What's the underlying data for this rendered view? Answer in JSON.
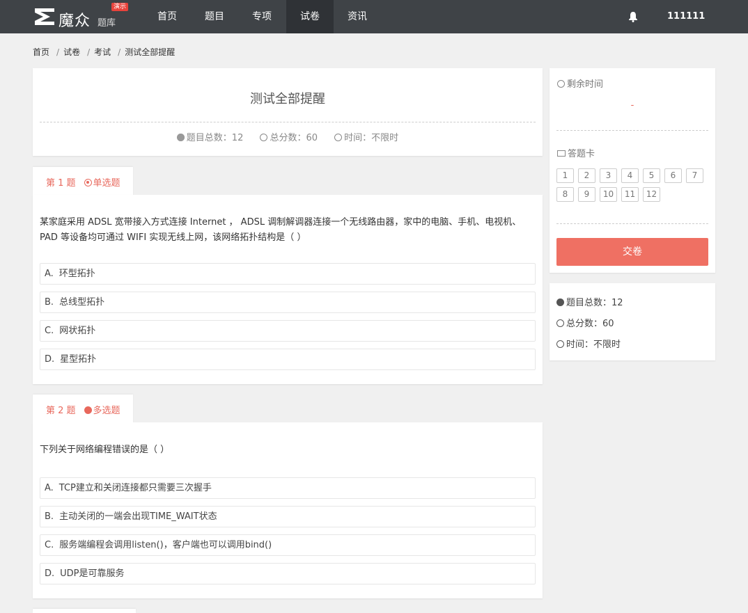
{
  "header": {
    "logo_main": "魔众",
    "logo_sub": "题库",
    "logo_badge": "演示",
    "nav": [
      "首页",
      "题目",
      "专项",
      "试卷",
      "资讯"
    ],
    "active_nav": "试卷",
    "username": "111111"
  },
  "breadcrumb": [
    "首页",
    "试卷",
    "考试",
    "测试全部提醒"
  ],
  "paper": {
    "title": "测试全部提醒",
    "total_questions_label": "题目总数：12",
    "total_score_label": "总分数：60",
    "time_label": "时间：不限时"
  },
  "questions": [
    {
      "number_label": "第 1 题",
      "type_label": "单选题",
      "text": "某家庭采用 ADSL 宽带接入方式连接 Internet ， ADSL 调制解调器连接一个无线路由器，家中的电脑、手机、电视机、 PAD 等设备均可通过 WIFI 实现无线上网，该网络拓扑结构是（ ）",
      "options": [
        {
          "key": "A.",
          "text": "环型拓扑"
        },
        {
          "key": "B.",
          "text": "总线型拓扑"
        },
        {
          "key": "C.",
          "text": "网状拓扑"
        },
        {
          "key": "D.",
          "text": "星型拓扑"
        }
      ]
    },
    {
      "number_label": "第 2 题",
      "type_label": "多选题",
      "text": "下列关于网络编程错误的是（ ）",
      "options": [
        {
          "key": "A.",
          "text": "TCP建立和关闭连接都只需要三次握手"
        },
        {
          "key": "B.",
          "text": "主动关闭的一端会出现TIME_WAIT状态"
        },
        {
          "key": "C.",
          "text": "服务端编程会调用listen()，客户端也可以调用bind()"
        },
        {
          "key": "D.",
          "text": "UDP是可靠服务"
        }
      ]
    }
  ],
  "sidebar": {
    "remaining_time_label": "剩余时间",
    "remaining_time_value": "-",
    "answer_card_label": "答题卡",
    "question_numbers": [
      "1",
      "2",
      "3",
      "4",
      "5",
      "6",
      "7",
      "8",
      "9",
      "10",
      "11",
      "12"
    ],
    "submit_label": "交卷",
    "total_questions_label": "题目总数：12",
    "total_score_label": "总分数：60",
    "time_label": "时间：不限时"
  },
  "colors": {
    "topbar": "#3f4347",
    "accent": "#ef7063",
    "accent_text": "#e8685c"
  }
}
